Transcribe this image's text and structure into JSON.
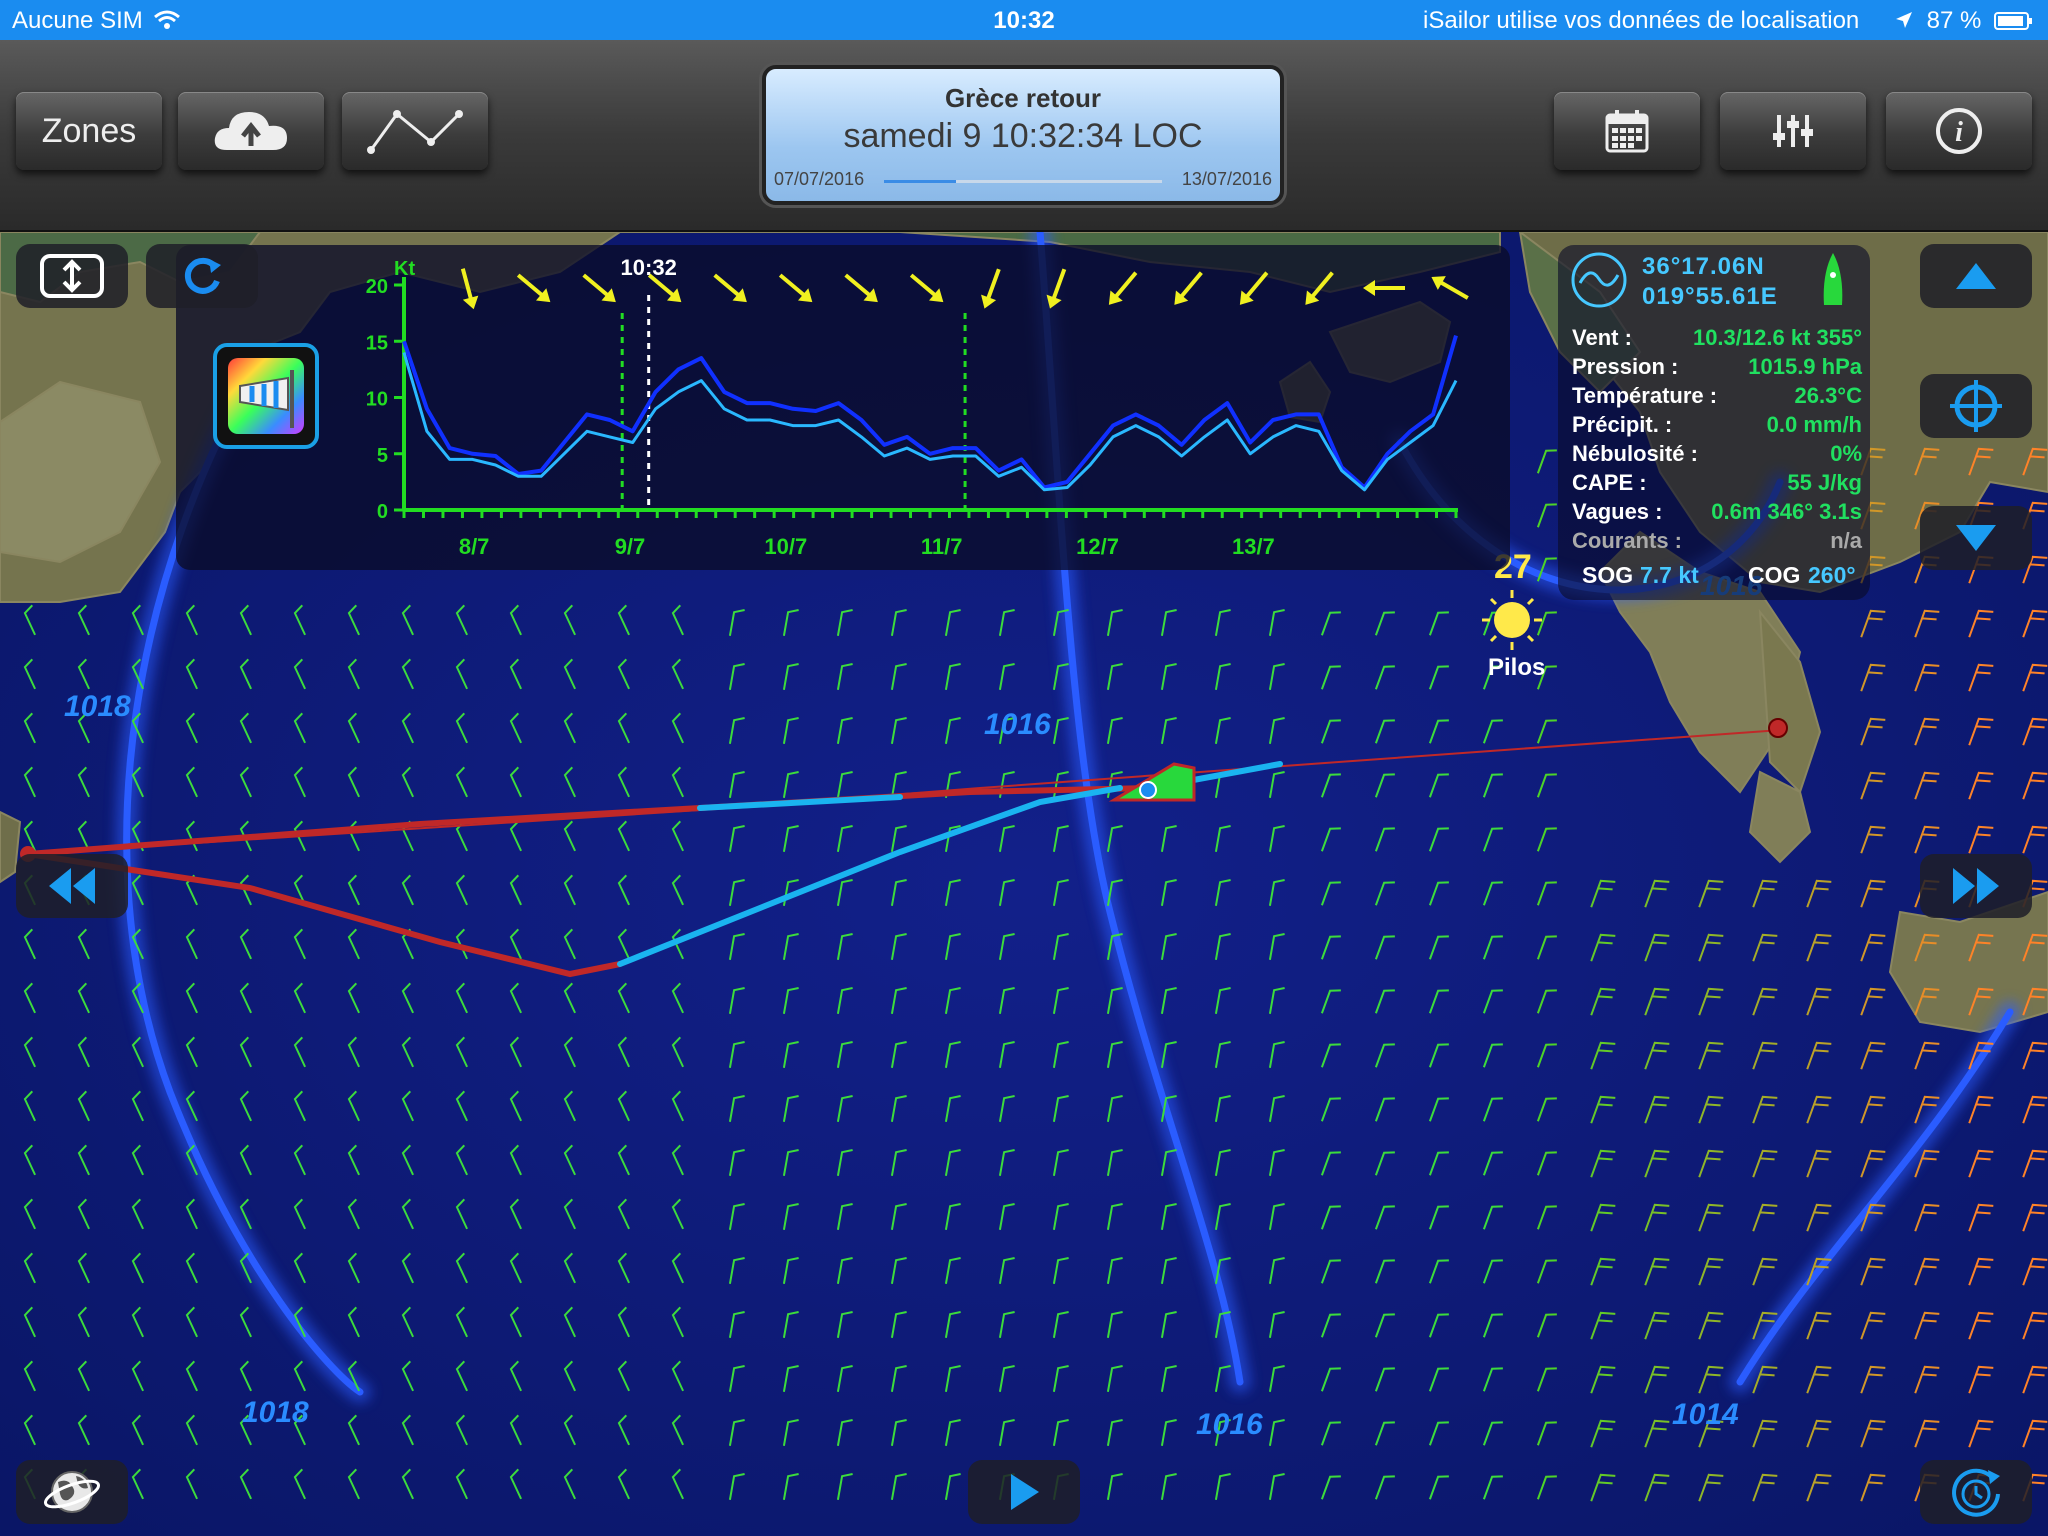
{
  "status": {
    "carrier": "Aucune SIM",
    "time": "10:32",
    "location_notice": "iSailor utilise vos données de localisation",
    "battery": "87 %"
  },
  "toolbar": {
    "zones_label": "Zones",
    "upload_icon": "cloud-upload-icon",
    "route_icon": "route-icon",
    "calendar_icon": "calendar-icon",
    "settings_icon": "sliders-icon",
    "info_icon": "info-icon"
  },
  "title": {
    "name": "Grèce retour",
    "datetime": "samedi 9 10:32:34 LOC",
    "start_date": "07/07/2016",
    "end_date": "13/07/2016",
    "progress": 0.26
  },
  "meteogram": {
    "unit": "Kt",
    "now_label": "10:32",
    "y_ticks": [
      "20",
      "15",
      "10",
      "5",
      "0"
    ],
    "date_labels": [
      "8/7",
      "9/7",
      "10/7",
      "11/7",
      "12/7",
      "13/7"
    ],
    "chart_data": {
      "type": "line",
      "ylabel": "Kt",
      "ylim": [
        0,
        20
      ],
      "xlim": [
        "07/07/2016",
        "13/07/2016 21:00"
      ],
      "series": [
        {
          "values": [
            15,
            9,
            5.5,
            5,
            4.8,
            3.2,
            3.5,
            6,
            8.5,
            8,
            7,
            10.5,
            12.5,
            13.5,
            10.5,
            9.5,
            9.5,
            9,
            8.8,
            9.5,
            8,
            5.8,
            6.5,
            5,
            5.5,
            5.5,
            3.5,
            4.5,
            2,
            2.5,
            5,
            7.5,
            8.5,
            7.5,
            5.8,
            8,
            9.5,
            6,
            8,
            8.5,
            8.5,
            3.8,
            2,
            5,
            7,
            8.5,
            15.5
          ]
        },
        {
          "values": [
            14,
            7,
            4.5,
            4.5,
            4,
            3,
            3,
            5,
            7,
            6.5,
            6,
            9,
            10.5,
            11.5,
            9,
            8,
            8,
            7.5,
            7.5,
            8,
            6.5,
            4.8,
            5.5,
            4.5,
            4.8,
            4.8,
            3,
            3.8,
            1.8,
            2,
            4,
            6.5,
            7.5,
            6.5,
            4.8,
            6.5,
            8,
            5,
            6.5,
            7.5,
            7,
            3.5,
            1.8,
            4.5,
            6,
            7.5,
            11.5
          ]
        }
      ]
    },
    "arrow_directions_deg": [
      165,
      130,
      130,
      130,
      130,
      130,
      130,
      130,
      200,
      200,
      220,
      220,
      220,
      220,
      270,
      300
    ]
  },
  "info": {
    "latitude": "36°17.06N",
    "longitude": "019°55.61E",
    "rows": [
      {
        "label": "Vent :",
        "value": "10.3/12.6 kt 355°"
      },
      {
        "label": "Pression :",
        "value": "1015.9 hPa"
      },
      {
        "label": "Température :",
        "value": "26.3°C"
      },
      {
        "label": "Précipit. :",
        "value": "0.0 mm/h"
      },
      {
        "label": "Nébulosité :",
        "value": "0%"
      },
      {
        "label": "CAPE :",
        "value": "55 J/kg"
      },
      {
        "label": "Vagues :",
        "value": "0.6m 346° 3.1s"
      },
      {
        "label": "Courants :",
        "value": "n/a"
      }
    ],
    "sog_label": "SOG",
    "sog_value": "7.7 kt",
    "cog_label": "COG",
    "cog_value": "260°"
  },
  "map": {
    "isobar_labels": [
      "1018",
      "1016",
      "1018",
      "1016",
      "1014",
      "1016"
    ],
    "city_name": "Pilos",
    "city_temp": "27"
  },
  "colors": {
    "status_bar": "#1a8cf0",
    "sea": "#0c1a78",
    "isobar": "#1e50ff",
    "route_past": "#c02828",
    "route_future": "#1ab4f0",
    "chart_axis": "#22dd22",
    "wind_arrow": "#f0f020"
  }
}
